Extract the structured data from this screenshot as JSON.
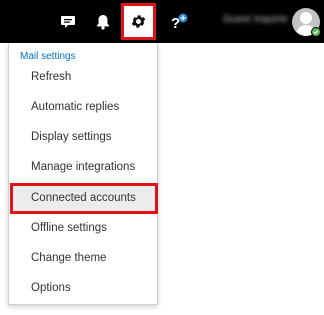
{
  "topbar": {
    "icons": [
      "feedback-icon",
      "bell-icon",
      "gear-icon",
      "help-icon"
    ],
    "user_name": "Guest Inquiries",
    "highlight_color": "#e2121a",
    "background_color": "#000000"
  },
  "menu": {
    "header": "Mail settings",
    "items": [
      {
        "label": "Refresh"
      },
      {
        "label": "Automatic replies"
      },
      {
        "label": "Display settings"
      },
      {
        "label": "Manage integrations"
      },
      {
        "label": "Connected accounts",
        "selected": true
      },
      {
        "label": "Offline settings"
      },
      {
        "label": "Change theme"
      },
      {
        "label": "Options"
      }
    ],
    "header_color": "#0072c6"
  }
}
